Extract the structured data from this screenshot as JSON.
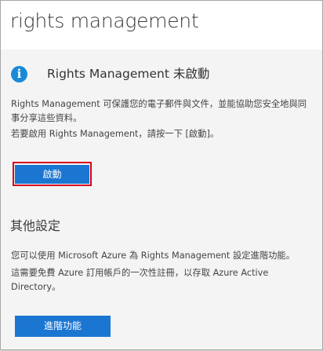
{
  "header": {
    "title": "rights management"
  },
  "status": {
    "icon": "info-icon",
    "icon_glyph": "i",
    "heading": "Rights Management 未啟動",
    "accent_color": "#1a8ad6"
  },
  "description": {
    "text": "Rights Management 可保護您的電子郵件與文件，並能協助您安全地與同事分享這些資料。",
    "prompt": "若要啟用 Rights Management，請按一下 [啟動]。"
  },
  "actions": {
    "activate_label": "啟動",
    "highlight_color": "#d4001d",
    "button_color": "#1b76d2"
  },
  "other_settings": {
    "heading": "其他設定",
    "azure_text": "您可以使用 Microsoft Azure 為 Rights Management 設定進階功能。",
    "azure_note": "這需要免費 Azure 訂用帳戶的一次性註冊，以存取 Azure Active Directory。",
    "advanced_label": "進階功能"
  }
}
